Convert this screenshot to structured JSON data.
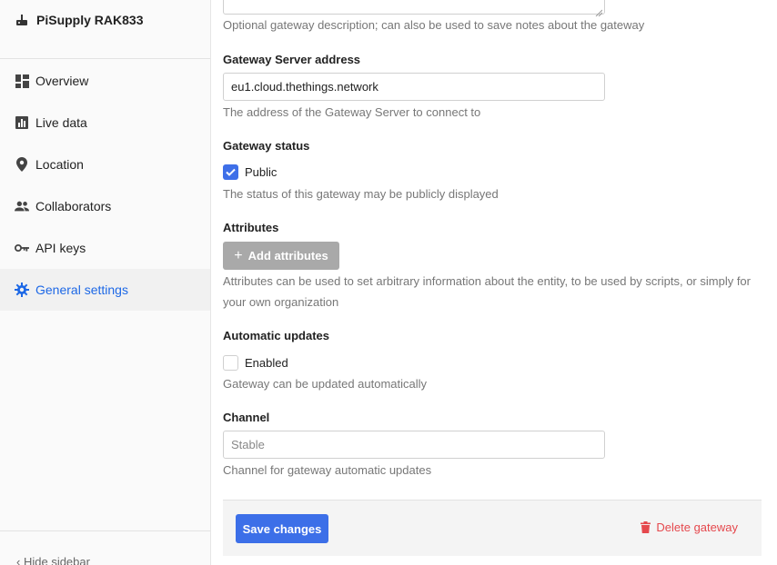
{
  "sidebar": {
    "gateway_name": "PiSupply RAK833",
    "items": [
      {
        "label": "Overview",
        "icon": "dashboard-icon"
      },
      {
        "label": "Live data",
        "icon": "bar-chart-icon"
      },
      {
        "label": "Location",
        "icon": "location-pin-icon"
      },
      {
        "label": "Collaborators",
        "icon": "people-icon"
      },
      {
        "label": "API keys",
        "icon": "key-icon"
      },
      {
        "label": "General settings",
        "icon": "gear-icon",
        "active": true
      }
    ],
    "hide_label": "Hide sidebar"
  },
  "form": {
    "description_help": "Optional gateway description; can also be used to save notes about the gateway",
    "server_address": {
      "label": "Gateway Server address",
      "value": "eu1.cloud.thethings.network",
      "help": "The address of the Gateway Server to connect to"
    },
    "status": {
      "label": "Gateway status",
      "checkbox_label": "Public",
      "checked": true,
      "help": "The status of this gateway may be publicly displayed"
    },
    "attributes": {
      "label": "Attributes",
      "button_label": "Add attributes",
      "help_line1": "Attributes can be used to set arbitrary information about the entity, to be used by scripts, or simply for",
      "help_line2": "your own organization"
    },
    "auto_updates": {
      "label": "Automatic updates",
      "checkbox_label": "Enabled",
      "checked": false,
      "help": "Gateway can be updated automatically"
    },
    "channel": {
      "label": "Channel",
      "placeholder": "Stable",
      "help": "Channel for gateway automatic updates"
    }
  },
  "actions": {
    "save_label": "Save changes",
    "delete_label": "Delete gateway"
  },
  "colors": {
    "accent": "#3c6fe8",
    "danger": "#e5484d"
  }
}
